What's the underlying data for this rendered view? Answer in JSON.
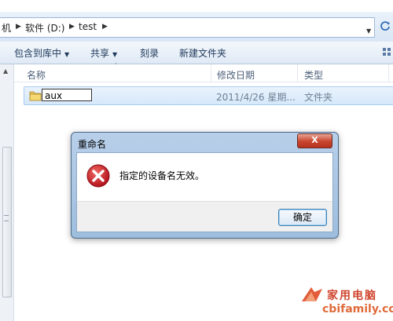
{
  "address": {
    "crumbs": [
      "机",
      "软件 (D:)",
      "test"
    ]
  },
  "toolbar": {
    "include_in_library": "包含到库中",
    "share": "共享",
    "burn": "刻录",
    "new_folder": "新建文件夹"
  },
  "columns": {
    "name": "名称",
    "modified": "修改日期",
    "type": "类型"
  },
  "file": {
    "name": "aux",
    "modified": "2011/4/26 星期...",
    "type": "文件夹"
  },
  "dialog": {
    "title": "重命名",
    "message": "指定的设备名无效。",
    "ok_label": "确定",
    "close_label": "X"
  },
  "watermark": {
    "brand": "家用电脑",
    "url": "cbifamily.com"
  },
  "colors": {
    "error_red": "#c8202a",
    "selection_blue": "#d6e8fb",
    "dialog_frame": "#a9c3e3",
    "watermark": "#d0452e"
  }
}
